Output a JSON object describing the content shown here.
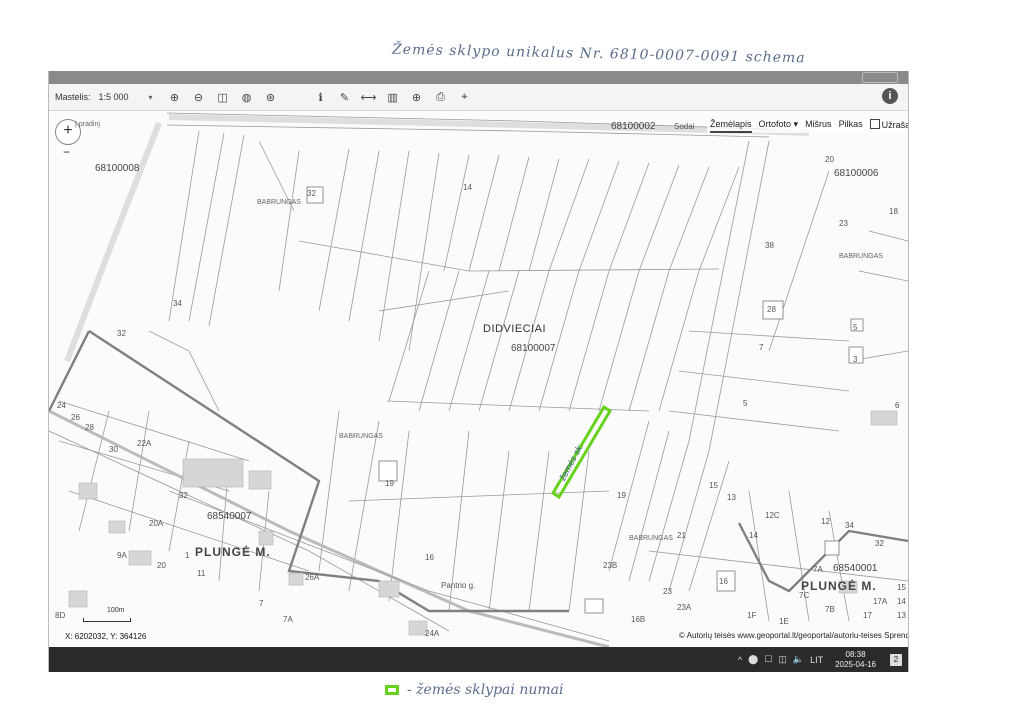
{
  "handwritten_title": "Žemės sklypo unikalus Nr. 6810-0007-0091 schema",
  "legend": {
    "text": "- žemės sklypai numai",
    "swatch_color": "#66d21c"
  },
  "toolbar": {
    "scale_label": "Mastelis:",
    "scale_value": "1:5 000",
    "caret": "▾",
    "tools": [
      "zoom-in-icon",
      "zoom-out-icon",
      "zoom-extent-icon",
      "globe-icon",
      "crosshair-icon",
      "info-point-icon",
      "link-icon",
      "measure-icon",
      "profile-icon",
      "add-icon",
      "print-icon",
      "locate-icon"
    ],
    "tool_glyphs": [
      "⊕",
      "⊖",
      "◫",
      "◍",
      "⊛",
      "ℹ",
      "✎",
      "⟷",
      "▥",
      "⊕",
      "⎙",
      "⌖"
    ],
    "info": "i"
  },
  "map_controls": {
    "zoom_in": "+",
    "zoom_out": "−",
    "tooltip": "Į pradinį"
  },
  "layers": {
    "items": [
      "Žemėlapis",
      "Ortofoto ▾",
      "Mišrus",
      "Pilkas"
    ],
    "checkbox_label": "Užrašai",
    "active": "Žemėlapis"
  },
  "map_labels": {
    "top_road_code": "68100002",
    "top_road_name": "Sodai",
    "area_codes": [
      "68100008",
      "68100006",
      "68540007",
      "68540001"
    ],
    "center_name": "DIDVIECIAI",
    "center_code": "68100007",
    "place_names": [
      "PLUNGĖ M.",
      "PLUNGĖ M."
    ],
    "babrungas": [
      "BABRUNGAS",
      "BABRUNGAS",
      "BABRUNGAS",
      "BABRUNGAS"
    ],
    "street": "Pantrio g.",
    "parcel_numbers": [
      "34",
      "32",
      "24",
      "26",
      "28",
      "30",
      "22A",
      "32",
      "20A",
      "9A",
      "20",
      "11",
      "1",
      "7",
      "7A",
      "26A",
      "24A",
      "8D",
      "19",
      "16",
      "15",
      "14",
      "20",
      "28",
      "23",
      "18",
      "5",
      "3",
      "6",
      "7",
      "5",
      "13",
      "12C",
      "12",
      "14",
      "34",
      "32",
      "23B",
      "21",
      "19",
      "23",
      "23A",
      "16B",
      "16",
      "1F",
      "1E",
      "7C",
      "7B",
      "7A",
      "17A",
      "15",
      "14",
      "13",
      "17",
      "32",
      "38"
    ],
    "annotation": "žemės sk."
  },
  "scale_bar": "100m",
  "coordinates": "X: 6202032, Y: 364126",
  "attribution": "© Autorių teisės www.geoportal.lt/geoportal/autoriu-teises  Sprendimas",
  "side_code": "68100002",
  "taskbar": {
    "tray_icons": [
      "^",
      "⬤",
      "☐",
      "◫",
      "🔈"
    ],
    "language": "LIT",
    "time": "08:38",
    "date": "2025-04-16",
    "notify": "2"
  }
}
